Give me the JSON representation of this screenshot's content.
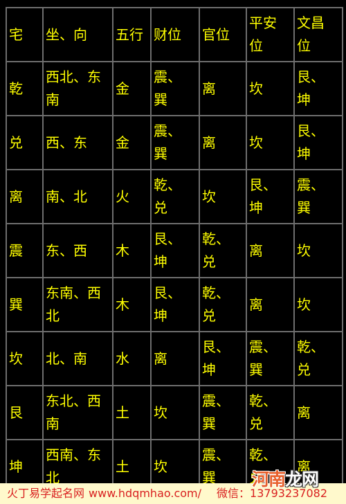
{
  "table": {
    "headers": [
      "宅",
      "坐、向",
      "五行",
      "财位",
      "官位",
      "平安位",
      "文昌位"
    ],
    "rows": [
      [
        "乾",
        "西北、东南",
        "金",
        "震、巽",
        "离",
        "坎",
        "艮、坤"
      ],
      [
        "兑",
        "西、东",
        "金",
        "震、巽",
        "离",
        "坎",
        "艮、坤"
      ],
      [
        "离",
        "南、北",
        "火",
        "乾、兑",
        "坎",
        "艮、坤",
        "震、巽"
      ],
      [
        "震",
        "东、西",
        "木",
        "艮、坤",
        "乾、兑",
        "离",
        "坎"
      ],
      [
        "巽",
        "东南、西北",
        "木",
        "艮、坤",
        "乾、兑",
        "离",
        "坎"
      ],
      [
        "坎",
        "北、南",
        "水",
        "离",
        "艮、坤",
        "震、巽",
        "乾、兑"
      ],
      [
        "艮",
        "东北、西南",
        "土",
        "坎",
        "震、巽",
        "乾、兑",
        "离"
      ],
      [
        "坤",
        "西南、东北",
        "土",
        "坎",
        "震、巽",
        "乾、兑",
        "离"
      ]
    ]
  },
  "footer": {
    "site_name": "火丁易学起名网",
    "url": "www.hdqmhao.com/",
    "wechat_label": "微信：",
    "wechat_number": "13793237082"
  },
  "watermark": {
    "part1": "河南",
    "part2": "龙网"
  },
  "colors": {
    "background": "#000000",
    "text": "#ffff00",
    "grid_lines": "#6e6e6e",
    "footer_background": "#fff9cc",
    "footer_text": "#d92020",
    "watermark_accent": "#e8602c"
  }
}
